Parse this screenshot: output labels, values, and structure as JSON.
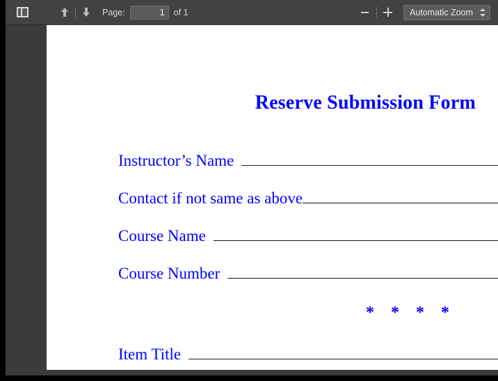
{
  "toolbar": {
    "sidebar_toggle_name": "sidebar-panel-icon",
    "prev_page_name": "arrow-up-icon",
    "next_page_name": "arrow-down-icon",
    "page_label": "Page:",
    "page_value": "1",
    "page_total": "of 1",
    "zoom_out_name": "minus-icon",
    "zoom_in_name": "plus-icon",
    "zoom_value": "Automatic Zoom",
    "zoom_spinner_name": "spinner-arrows-icon"
  },
  "document": {
    "title": "Reserve Submission Form",
    "asterisks": "* * * *",
    "accent_color": "#0000ff",
    "rule_color": "#1a1a1a",
    "fields": [
      {
        "label": "Instructor’s Name",
        "gap": "wide"
      },
      {
        "label": "Contact if not same as above",
        "gap": "none"
      },
      {
        "label": "Course Name",
        "gap": "wide"
      },
      {
        "label": "Course Number",
        "gap": "wide"
      },
      {
        "label": "Item Title",
        "gap": "wide"
      }
    ]
  },
  "theme": {
    "toolbar_bg": "#424242",
    "viewer_bg": "#3b3b3b",
    "page_bg": "#ffffff",
    "frame_color": "#000000"
  }
}
